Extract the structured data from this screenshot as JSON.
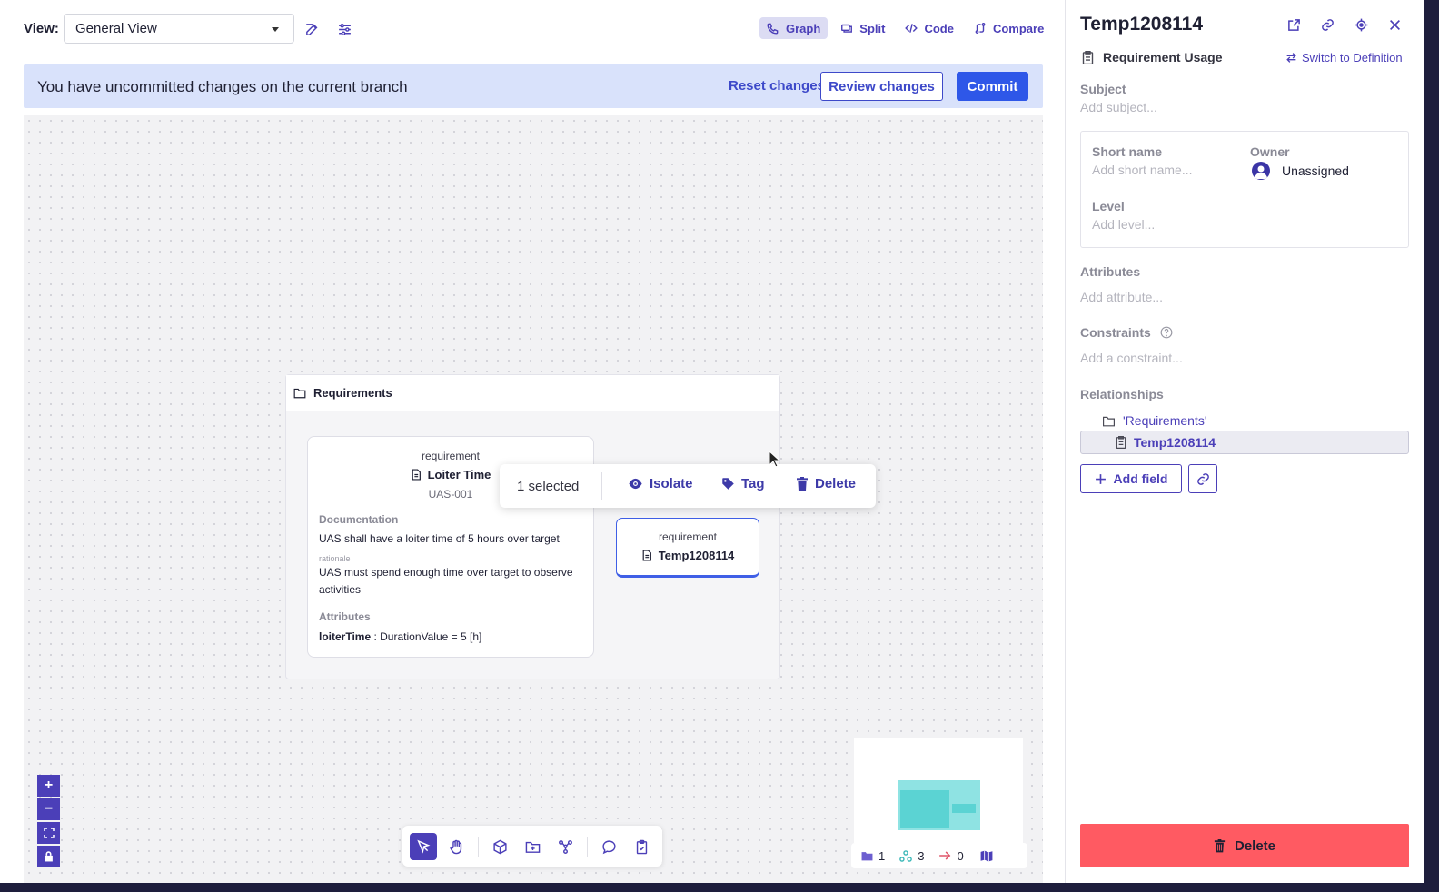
{
  "toolbar": {
    "view_label": "View:",
    "view_value": "General View",
    "modes": [
      {
        "label": "Graph",
        "icon": "graph-icon",
        "active": true
      },
      {
        "label": "Split",
        "icon": "split-icon",
        "active": false
      },
      {
        "label": "Code",
        "icon": "code-icon",
        "active": false
      },
      {
        "label": "Compare",
        "icon": "compare-icon",
        "active": false
      }
    ]
  },
  "banner": {
    "message": "You have uncommitted changes on the current branch",
    "reset_label": "Reset changes",
    "review_label": "Review changes",
    "commit_label": "Commit"
  },
  "canvas": {
    "group_title": "Requirements",
    "req_card": {
      "type": "requirement",
      "name": "Loiter Time",
      "id": "UAS-001",
      "doc_title": "Documentation",
      "doc_text": "UAS shall have a loiter time of 5 hours over target",
      "rationale_label": "rationale",
      "rationale_text": "UAS must spend enough time over target to observe activities",
      "attr_title": "Attributes",
      "attr_name": "loiterTime",
      "attr_value": " : DurationValue = 5 [h]"
    },
    "selection_popup": {
      "count": "1 selected",
      "isolate": "Isolate",
      "tag": "Tag",
      "delete": "Delete"
    },
    "req2": {
      "type": "requirement",
      "name": "Temp1208114"
    },
    "zoom": {
      "in": "+",
      "out": "−"
    },
    "stats": {
      "packages": "1",
      "elements": "3",
      "relations": "0"
    }
  },
  "sidebar": {
    "title": "Temp1208114",
    "element_type": "Requirement Usage",
    "switch_label": "Switch to Definition",
    "subject_label": "Subject",
    "subject_placeholder": "Add subject...",
    "short_name_label": "Short name",
    "short_name_placeholder": "Add short name...",
    "owner_label": "Owner",
    "owner_value": "Unassigned",
    "level_label": "Level",
    "level_placeholder": "Add level...",
    "attributes_label": "Attributes",
    "attributes_placeholder": "Add attribute...",
    "constraints_label": "Constraints",
    "constraints_placeholder": "Add a constraint...",
    "relationships_label": "Relationships",
    "rel_parent": "'Requirements'",
    "rel_self": "Temp1208114",
    "add_field_label": "Add field",
    "delete_label": "Delete"
  },
  "colors": {
    "accent": "#4b3fb8",
    "primary_button": "#2e57e8",
    "banner_bg": "#d9e2fb",
    "danger": "#ff5a62"
  }
}
